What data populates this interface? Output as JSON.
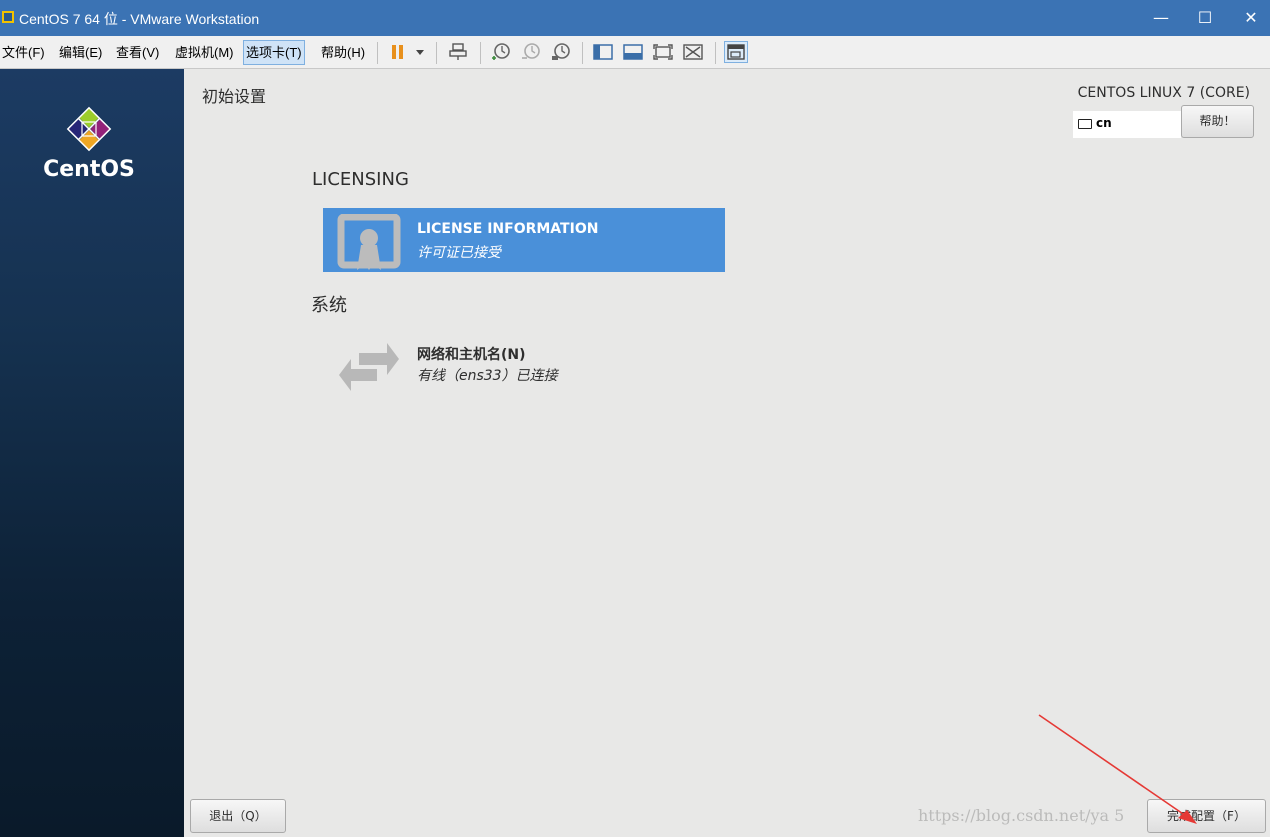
{
  "window": {
    "title": "CentOS 7 64 位 - VMware Workstation",
    "controls": {
      "minimize": "—",
      "maximize": "☐",
      "close": "✕"
    }
  },
  "menubar": {
    "items": [
      {
        "label": "文件(F)"
      },
      {
        "label": "编辑(E)"
      },
      {
        "label": "查看(V)"
      },
      {
        "label": "虚拟机(M)"
      },
      {
        "label": "选项卡(T)"
      },
      {
        "label": "帮助(H)"
      }
    ],
    "toolbar_icons": [
      "pause-icon",
      "dropdown-arrow-icon",
      "send-ctrl-alt-del-icon",
      "snapshot-take-icon",
      "snapshot-revert-icon",
      "snapshot-manager-icon",
      "library-icon",
      "console-view-icon",
      "fullscreen-icon",
      "unity-icon",
      "thumbnail-view-icon"
    ]
  },
  "sidebar": {
    "logo_text": "CentOS"
  },
  "main": {
    "title": "初始设置",
    "product": "CENTOS LINUX 7 (CORE)",
    "keyboard_layout": "cn",
    "help_label": "帮助！",
    "sections": {
      "licensing": {
        "heading": "LICENSING",
        "spoke_title": "LICENSE INFORMATION",
        "spoke_status": "许可证已接受"
      },
      "system": {
        "heading": "系统",
        "spoke_title": "网络和主机名(N)",
        "spoke_status": "有线（ens33）已连接"
      }
    },
    "quit_label": "退出（Q）",
    "finish_label": "完成配置（F）"
  },
  "watermark": "https://blog.csdn.net/ya   5",
  "colors": {
    "accent": "#4a90d9",
    "titlebar": "#3b73b4",
    "annotation_arrow": "#e53935"
  }
}
